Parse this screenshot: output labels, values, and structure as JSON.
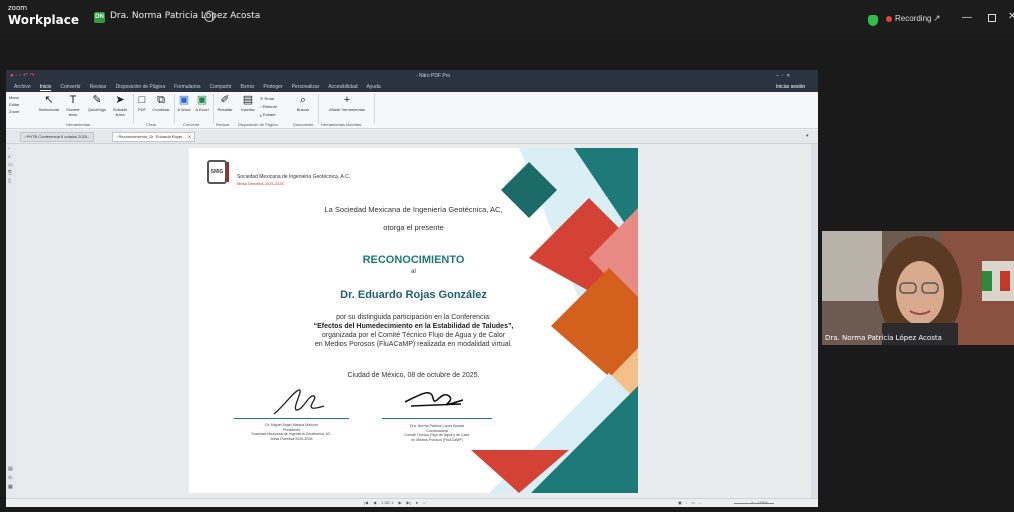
{
  "zoom": {
    "brand_small": "zoom",
    "brand": "Workplace",
    "host_initials": "DN",
    "host_name": "Dra. Norma Patricia López Acosta",
    "recording_label": "Recording",
    "video_name": "Dra. Norma Patricia López Acosta"
  },
  "app": {
    "window_title": "- Nitro PDF Pro",
    "menu": [
      "Archivo",
      "Inicio",
      "Convertir",
      "Revisar",
      "Disposición de Página",
      "Formularios",
      "Compartir",
      "Borrar",
      "Proteger",
      "Personalizar",
      "Accesibilidad",
      "Ayuda"
    ],
    "signin": "Iniciar sesión",
    "left_modes": [
      "Mano",
      "Editar",
      "Zoom"
    ],
    "ribbon_tools": [
      {
        "label": "Seleccionar",
        "icon": "cursor-icon"
      },
      {
        "label": "Escribir texto",
        "icon": "text-icon"
      },
      {
        "label": "QuickSign",
        "icon": "pen-icon"
      },
      {
        "label": "Solicitar firma",
        "icon": "send-icon"
      },
      {
        "label": "PDF",
        "icon": "pdf-icon"
      },
      {
        "label": "Combinar",
        "icon": "combine-icon"
      },
      {
        "label": "A Word",
        "icon": "word-icon"
      },
      {
        "label": "A Excel",
        "icon": "excel-icon"
      },
      {
        "label": "Resaltar",
        "icon": "highlight-icon"
      },
      {
        "label": "Insertar",
        "icon": "insert-icon"
      },
      {
        "label": "Rotar",
        "icon": "rotate-icon"
      },
      {
        "label": "Eliminar",
        "icon": "delete-icon"
      },
      {
        "label": "Extraer",
        "icon": "extract-icon"
      },
      {
        "label": "Buscar",
        "icon": "search-icon"
      },
      {
        "label": "Añadir herramientas",
        "icon": "plus-icon"
      }
    ],
    "ribbon_groups": [
      "Herramientas",
      "Crear",
      "Convertir",
      "Revisar",
      "Disposición de Página",
      "Documento",
      "Herramientas favoritas"
    ],
    "tabs": [
      "PHTB Conferencia II cotalos 2025...",
      "Reconocimiento_Dr. Eduardo Rojas ..."
    ],
    "page_indicator": "1 DE 1",
    "zoom_pct": "100%"
  },
  "certificate": {
    "org_name": "Sociedad Mexicana de Ingeniería Geotécnica, A.C.",
    "mesa": "Mesa Directiva 2025-2026",
    "logo_text": "SMIG",
    "line1": "La Sociedad Mexicana de Ingeniería Geotécnica, AC,",
    "line2": "otorga el presente",
    "title": "RECONOCIMIENTO",
    "al": "al",
    "recipient": "Dr. Eduardo Rojas González",
    "body1": "por su distinguida participación en la Conferencia:",
    "body2": "“Efectos del Humedecimiento en la Estabilidad de Taludes”,",
    "body3": "organizada por el Comité Técnico Flujo de Agua y de Calor",
    "body4": "en Medios Porosos (FluACaMP) realizada en modalidad virtual.",
    "date": "Ciudad de México, 08 de octubre de 2025.",
    "sig1": [
      "Dr. Miguel Ángel Mánica Malcom",
      "Presidente",
      "Sociedad Mexicana de Ingeniería Geotécnica, AC.",
      "Mesa Directiva 2025-2026"
    ],
    "sig2": [
      "Dra. Norma Patricia López Acosta",
      "Coordinadora",
      "Comité Técnico Flujo de Agua y de Calor",
      "en Medios Porosos (FluACaMP)"
    ]
  },
  "colors": {
    "teal": "#1e7a78",
    "red": "#c0392b",
    "orange": "#d4601e",
    "lightblue": "#bfe3ee",
    "accent": "#2d9c3c"
  }
}
